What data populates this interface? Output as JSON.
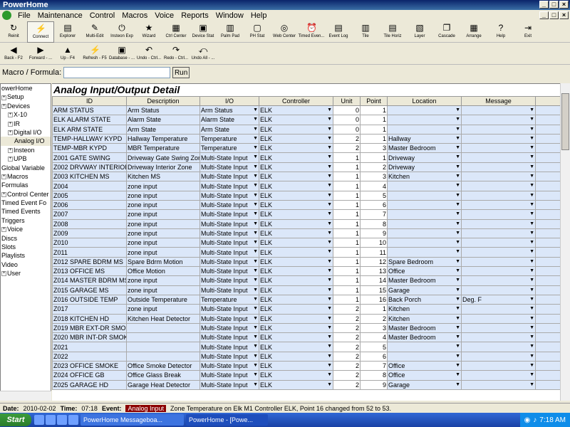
{
  "app": {
    "title": "PowerHome",
    "window_title": "PowerHome Explorer - [PowerHome Explorer - c:\\program files (x86)\\powerhome\\database\\pwrhome.db]"
  },
  "menu": [
    "File",
    "Maintenance",
    "Control",
    "Macros",
    "Voice",
    "Reports",
    "Window",
    "Help"
  ],
  "toolbar": [
    {
      "label": "Reinit",
      "icon": "refresh-icon"
    },
    {
      "label": "Connect",
      "icon": "connect-icon"
    },
    {
      "label": "Explorer",
      "icon": "explorer-icon"
    },
    {
      "label": "Multi-Edit",
      "icon": "multi-edit-icon"
    },
    {
      "label": "Insteon Exp",
      "icon": "power-icon"
    },
    {
      "label": "Wizard",
      "icon": "wizard-icon"
    },
    {
      "label": "Ctrl Center",
      "icon": "ctrl-center-icon"
    },
    {
      "label": "Device Stat",
      "icon": "device-stat-icon"
    },
    {
      "label": "Palm Pad",
      "icon": "palm-pad-icon"
    },
    {
      "label": "PH Stat",
      "icon": "ph-stat-icon"
    },
    {
      "label": "Web Center",
      "icon": "web-icon"
    },
    {
      "label": "Timed Even...",
      "icon": "timed-event-icon"
    },
    {
      "label": "Event Log",
      "icon": "event-log-icon"
    },
    {
      "label": "Tile",
      "icon": "tile-icon"
    },
    {
      "label": "Tile Horiz",
      "icon": "tile-horiz-icon"
    },
    {
      "label": "Layer",
      "icon": "layer-icon"
    },
    {
      "label": "Cascade",
      "icon": "cascade-icon"
    },
    {
      "label": "Arrange",
      "icon": "arrange-icon"
    },
    {
      "label": "Help",
      "icon": "help-icon"
    },
    {
      "label": "Exit",
      "icon": "exit-icon"
    }
  ],
  "toolbar2": [
    {
      "label": "Back - F2",
      "icon": "back-icon"
    },
    {
      "label": "Forward - ...",
      "icon": "forward-icon"
    },
    {
      "label": "Up - F4",
      "icon": "up-icon"
    },
    {
      "label": "Refresh - F5",
      "icon": "refresh2-icon"
    },
    {
      "label": "Database - ...",
      "icon": "database-icon"
    },
    {
      "label": "Undo - Ctrl...",
      "icon": "undo-icon"
    },
    {
      "label": "Redo - Ctrl...",
      "icon": "redo-icon"
    },
    {
      "label": "Undo All - ...",
      "icon": "undo-all-icon"
    }
  ],
  "macro": {
    "label": "Macro / Formula:",
    "value": "",
    "run": "Run"
  },
  "tree": [
    {
      "label": "owerHome",
      "indent": 0,
      "plus": false
    },
    {
      "label": "Setup",
      "indent": 0,
      "plus": true
    },
    {
      "label": "Devices",
      "indent": 0,
      "plus": true
    },
    {
      "label": "X-10",
      "indent": 1,
      "plus": true
    },
    {
      "label": "IR",
      "indent": 1,
      "plus": true
    },
    {
      "label": "Digital I/O",
      "indent": 1,
      "plus": true
    },
    {
      "label": "Analog I/O",
      "indent": 2,
      "plus": false,
      "selected": true
    },
    {
      "label": "Insteon",
      "indent": 1,
      "plus": true
    },
    {
      "label": "UPB",
      "indent": 1,
      "plus": true
    },
    {
      "label": "Global Variable",
      "indent": 0,
      "plus": false
    },
    {
      "label": "Macros",
      "indent": 0,
      "plus": true
    },
    {
      "label": "Formulas",
      "indent": 0,
      "plus": false
    },
    {
      "label": "Control Center",
      "indent": 0,
      "plus": true
    },
    {
      "label": "Timed Event Fo",
      "indent": 0,
      "plus": false
    },
    {
      "label": "Timed Events",
      "indent": 0,
      "plus": false
    },
    {
      "label": "Triggers",
      "indent": 0,
      "plus": false
    },
    {
      "label": "Voice",
      "indent": 0,
      "plus": true
    },
    {
      "label": "Discs",
      "indent": 0,
      "plus": false
    },
    {
      "label": "Slots",
      "indent": 0,
      "plus": false
    },
    {
      "label": "Playlists",
      "indent": 0,
      "plus": false
    },
    {
      "label": "Video",
      "indent": 0,
      "plus": false
    },
    {
      "label": "User",
      "indent": 0,
      "plus": true
    }
  ],
  "grid": {
    "title": "Analog Input/Output Detail",
    "columns": [
      "ID",
      "Description",
      "I/O",
      "Controller",
      "Unit",
      "Point",
      "Location",
      "Message"
    ],
    "rows": [
      [
        "ARM STATUS",
        "Arm Status",
        "Arm Status",
        "ELK",
        "0",
        "1",
        "",
        ""
      ],
      [
        "ELK ALARM STATE",
        "Alarm State",
        "Alarm State",
        "ELK",
        "0",
        "1",
        "",
        ""
      ],
      [
        "ELK ARM STATE",
        "Arm State",
        "Arm State",
        "ELK",
        "0",
        "1",
        "",
        ""
      ],
      [
        "TEMP-HALLWAY KYPD",
        "Hallway Temperature",
        "Temperature",
        "ELK",
        "2",
        "1",
        "Hallway",
        ""
      ],
      [
        "TEMP-MBR KYPD",
        "MBR Temperature",
        "Temperature",
        "ELK",
        "2",
        "3",
        "Master Bedroom",
        ""
      ],
      [
        "Z001 GATE SWING",
        "Driveway Gate Swing Zone",
        "Multi-State Input",
        "ELK",
        "1",
        "1",
        "Driveway",
        ""
      ],
      [
        "Z002 DRVWAY INTERIOR",
        "Driveway Interior Zone",
        "Multi-State Input",
        "ELK",
        "1",
        "2",
        "Driveway",
        ""
      ],
      [
        "Z003 KITCHEN MS",
        "Kitchen MS",
        "Multi-State Input",
        "ELK",
        "1",
        "3",
        "Kitchen",
        ""
      ],
      [
        "Z004",
        "zone input",
        "Multi-State Input",
        "ELK",
        "1",
        "4",
        "",
        ""
      ],
      [
        "Z005",
        "zone input",
        "Multi-State Input",
        "ELK",
        "1",
        "5",
        "",
        ""
      ],
      [
        "Z006",
        "zone input",
        "Multi-State Input",
        "ELK",
        "1",
        "6",
        "",
        ""
      ],
      [
        "Z007",
        "zone input",
        "Multi-State Input",
        "ELK",
        "1",
        "7",
        "",
        ""
      ],
      [
        "Z008",
        "zone input",
        "Multi-State Input",
        "ELK",
        "1",
        "8",
        "",
        ""
      ],
      [
        "Z009",
        "zone input",
        "Multi-State Input",
        "ELK",
        "1",
        "9",
        "",
        ""
      ],
      [
        "Z010",
        "zone input",
        "Multi-State Input",
        "ELK",
        "1",
        "10",
        "",
        ""
      ],
      [
        "Z011",
        "zone input",
        "Multi-State Input",
        "ELK",
        "1",
        "11",
        "",
        ""
      ],
      [
        "Z012 SPARE BDRM MS",
        "Spare Bdrm Motion",
        "Multi-State Input",
        "ELK",
        "1",
        "12",
        "Spare Bedroom",
        ""
      ],
      [
        "Z013 OFFICE MS",
        "Office Motion",
        "Multi-State Input",
        "ELK",
        "1",
        "13",
        "Office",
        ""
      ],
      [
        "Z014 MASTER BDRM MS",
        "zone input",
        "Multi-State Input",
        "ELK",
        "1",
        "14",
        "Master Bedroom",
        ""
      ],
      [
        "Z015 GARAGE MS",
        "zone input",
        "Multi-State Input",
        "ELK",
        "1",
        "15",
        "Garage",
        ""
      ],
      [
        "Z016 OUTSIDE TEMP",
        "Outside Temperature",
        "Temperature",
        "ELK",
        "1",
        "16",
        "Back Porch",
        "Deg. F"
      ],
      [
        "Z017",
        "zone input",
        "Multi-State Input",
        "ELK",
        "2",
        "1",
        "Kitchen",
        ""
      ],
      [
        "Z018 KITCHEN HD",
        "Kitchen Heat Detector",
        "Multi-State Input",
        "ELK",
        "2",
        "2",
        "Kitchen",
        ""
      ],
      [
        "Z019 MBR EXT-DR SMOKE",
        "",
        "Multi-State Input",
        "ELK",
        "2",
        "3",
        "Master Bedroom",
        ""
      ],
      [
        "Z020 MBR INT-DR SMOKE",
        "",
        "Multi-State Input",
        "ELK",
        "2",
        "4",
        "Master Bedroom",
        ""
      ],
      [
        "Z021",
        "",
        "Multi-State Input",
        "ELK",
        "2",
        "5",
        "",
        ""
      ],
      [
        "Z022",
        "",
        "Multi-State Input",
        "ELK",
        "2",
        "6",
        "",
        ""
      ],
      [
        "Z023 OFFICE SMOKE",
        "Office Smoke Detector",
        "Multi-State Input",
        "ELK",
        "2",
        "7",
        "Office",
        ""
      ],
      [
        "Z024 OFFICE GB",
        "Office Glass Break",
        "Multi-State Input",
        "ELK",
        "2",
        "8",
        "Office",
        ""
      ],
      [
        "Z025 GARAGE HD",
        "Garage Heat Detector",
        "Multi-State Input",
        "ELK",
        "2",
        "9",
        "Garage",
        ""
      ]
    ]
  },
  "status": {
    "date_label": "Date:",
    "date": "2010-02-02",
    "time_label": "Time:",
    "time": "07:18",
    "event_label": "Event:",
    "event": "Analog Input",
    "message": "Zone Temperature on Elk M1 Controller ELK, Point 16 changed from 52 to 53."
  },
  "taskbar": {
    "start": "Start",
    "tasks": [
      "PowerHome Messageboa...",
      "PowerHome - [Powe..."
    ],
    "clock": "7:18 AM"
  }
}
